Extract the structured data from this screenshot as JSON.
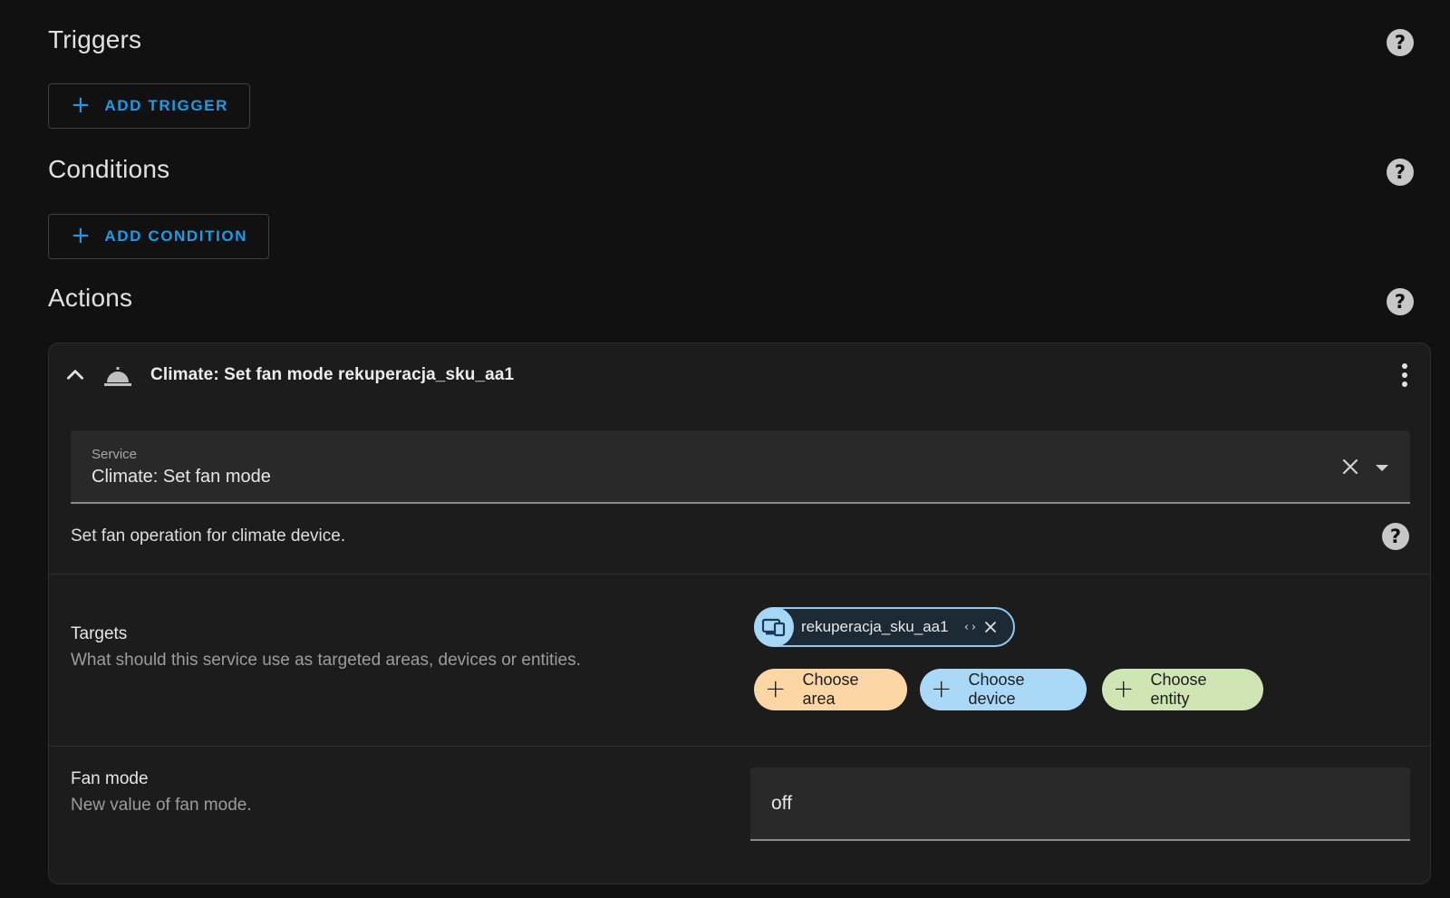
{
  "sections": {
    "triggers": {
      "title": "Triggers",
      "button": "ADD TRIGGER"
    },
    "conditions": {
      "title": "Conditions",
      "button": "ADD CONDITION"
    },
    "actions": {
      "title": "Actions"
    }
  },
  "help_glyph": "?",
  "plus_glyph": "+",
  "action_card": {
    "title": "Climate: Set fan mode rekuperacja_sku_aa1",
    "icon": "room-service-icon",
    "service": {
      "label": "Service",
      "value": "Climate: Set fan mode"
    },
    "description": "Set fan operation for climate device.",
    "targets": {
      "title": "Targets",
      "subtitle": "What should this service use as targeted areas, devices or entities.",
      "selected": [
        {
          "label": "rekuperacja_sku_aa1",
          "icon": "devices-icon",
          "code_glyph": "‹›"
        }
      ],
      "pickers": {
        "area": "Choose area",
        "device": "Choose device",
        "entity": "Choose entity"
      }
    },
    "fan_mode": {
      "title": "Fan mode",
      "subtitle": "New value of fan mode.",
      "value": "off"
    }
  },
  "colors": {
    "background": "#111111",
    "card": "#1c1c1c",
    "accent": "#1e9be6",
    "area": "#fdd6a6",
    "device": "#a9d9f7",
    "entity": "#cfe6b4"
  }
}
